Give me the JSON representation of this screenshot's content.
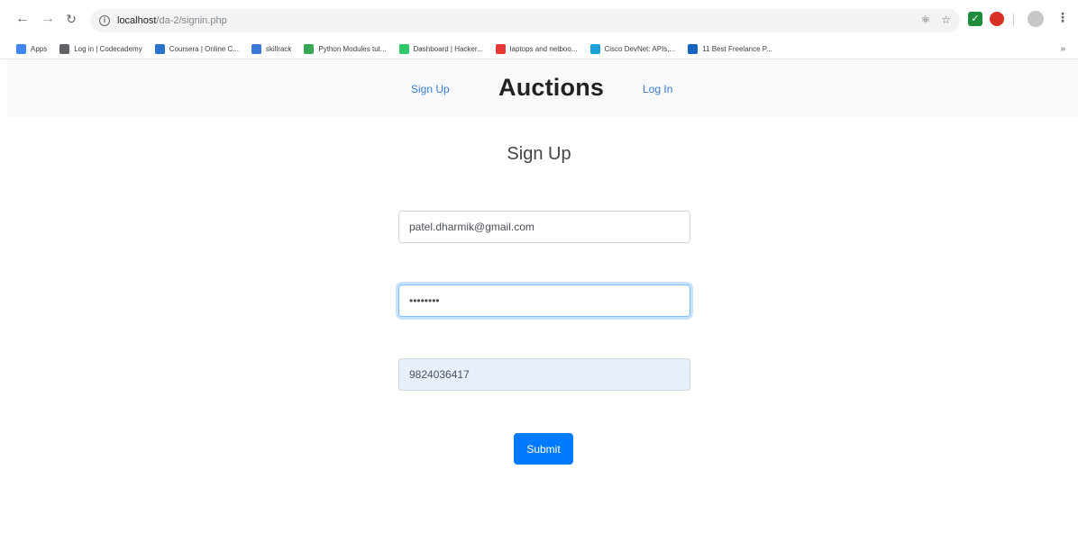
{
  "browser": {
    "url_host": "localhost",
    "url_path": "/da-2/signin.php",
    "info_icon": "i",
    "bookmarks": [
      {
        "label": "Apps",
        "color": "#4285f4"
      },
      {
        "label": "Log in | Codecademy",
        "color": "#5f6368"
      },
      {
        "label": "Coursera | Online C...",
        "color": "#2a73cc"
      },
      {
        "label": "skillrack",
        "color": "#3c78d8"
      },
      {
        "label": "Python Modules tut...",
        "color": "#34a853"
      },
      {
        "label": "Dashboard | Hacker...",
        "color": "#2ec866"
      },
      {
        "label": "laptops and netboo...",
        "color": "#e53935"
      },
      {
        "label": "Cisco DevNet: APIs,...",
        "color": "#1ba0d7"
      },
      {
        "label": "11 Best Freelance P...",
        "color": "#1565c0"
      }
    ],
    "more_bookmarks": "»"
  },
  "site_nav": {
    "signup_link": "Sign Up",
    "brand": "Auctions",
    "login_link": "Log In"
  },
  "form": {
    "heading": "Sign Up",
    "email_value": "patel.dharmik@gmail.com",
    "password_value": "********",
    "phone_value": "9824036417",
    "submit_label": "Submit"
  },
  "colors": {
    "primary": "#007bff",
    "link": "#3b7ddd",
    "navbar_bg": "#f8f9fa",
    "autofill_bg": "#e8f0fe"
  }
}
